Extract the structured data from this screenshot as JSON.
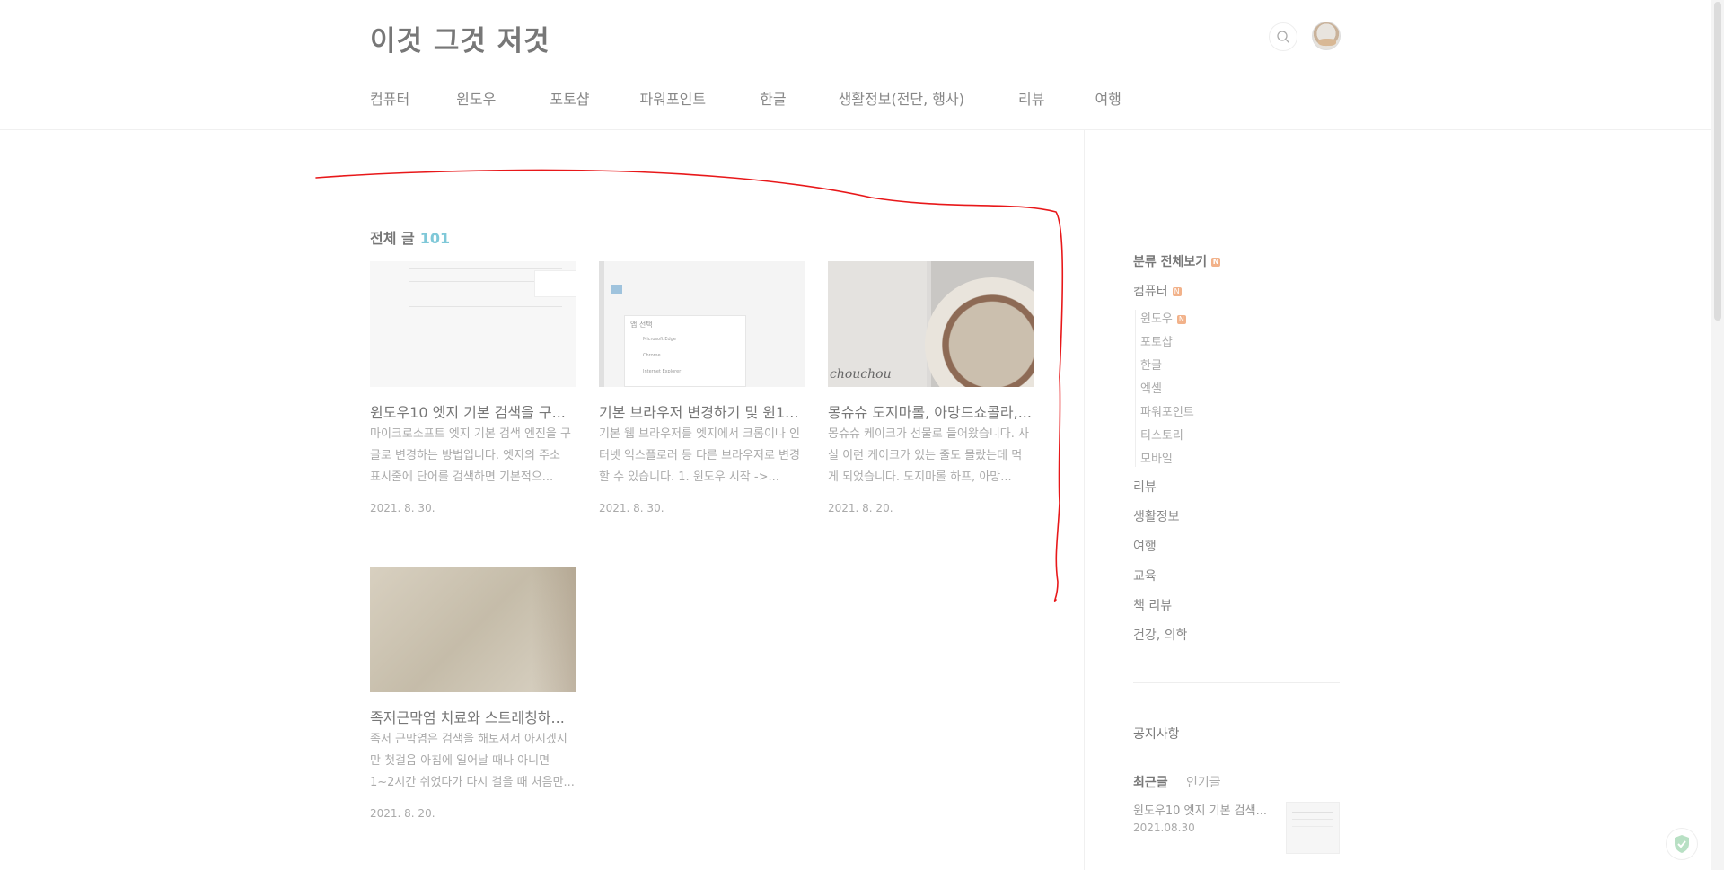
{
  "header": {
    "blog_title": "이것 그것 저것",
    "search_icon": "search-icon",
    "avatar_icon": "avatar"
  },
  "nav": {
    "items": [
      "컴퓨터",
      "윈도우",
      "포토샵",
      "파워포인트",
      "한글",
      "생활정보(전단, 행사)",
      "리뷰",
      "여행"
    ]
  },
  "main": {
    "section_title": "전체 글",
    "post_count": "101",
    "posts": [
      {
        "title": "윈도우10 엣지 기본 검색을 구...",
        "summary": "마이크로소프트 엣지 기본 검색 엔진을 구글로 변경하는 방법입니다. 엣지의 주소 표시줄에 단어를 검색하면 기본적으...",
        "date": "2021. 8. 30."
      },
      {
        "title": "기본 브라우저 변경하기 및 윈1...",
        "summary": "기본 웹 브라우저를 엣지에서 크롬이나 인터넷 익스플로러 등 다른 브라우저로 변경할 수 있습니다. 1. 윈도우 시작 ->...",
        "date": "2021. 8. 30."
      },
      {
        "title": "몽슈슈 도지마롤, 아망드쇼콜라,...",
        "summary": "몽슈슈 케이크가 선물로 들어왔습니다. 사실 이런 케이크가 있는 줄도 몰랐는데 먹게 되었습니다. 도지마롤 하프, 아망...",
        "date": "2021. 8. 20."
      },
      {
        "title": "족저근막염 치료와 스트레칭하...",
        "summary": "족저 근막염은 검색을 해보셔서 아시겠지만 첫걸음 아침에 일어날 때나 아니면 1~2시간 쉬었다가 다시 걸을 때 처음만...",
        "date": "2021. 8. 20."
      }
    ],
    "thumb2_labels": {
      "app_select": "앱 선택",
      "edge": "Microsoft Edge",
      "chrome": "Chrome",
      "ie": "Internet Explorer"
    },
    "thumb3_text": "chouchou"
  },
  "sidebar": {
    "category_all": "분류 전체보기",
    "categories": [
      {
        "label": "컴퓨터",
        "new": true
      },
      {
        "label": "리뷰"
      },
      {
        "label": "생활정보"
      },
      {
        "label": "여행"
      },
      {
        "label": "교육"
      },
      {
        "label": "책 리뷰"
      },
      {
        "label": "건강, 의학"
      }
    ],
    "subcategories": [
      {
        "label": "윈도우",
        "new": true
      },
      {
        "label": "포토샵"
      },
      {
        "label": "한글"
      },
      {
        "label": "엑셀"
      },
      {
        "label": "파워포인트"
      },
      {
        "label": "티스토리"
      },
      {
        "label": "모바일"
      }
    ],
    "new_badge": "N",
    "notice_title": "공지사항",
    "tabs": {
      "recent": "최근글",
      "popular": "인기글"
    },
    "recent_post": {
      "title": "윈도우10 엣지 기본 검색...",
      "date": "2021.08.30"
    }
  },
  "colors": {
    "accent_count": "#7fc8d8",
    "new_badge": "#f2b28a",
    "annotation_stroke": "#e8181a"
  }
}
